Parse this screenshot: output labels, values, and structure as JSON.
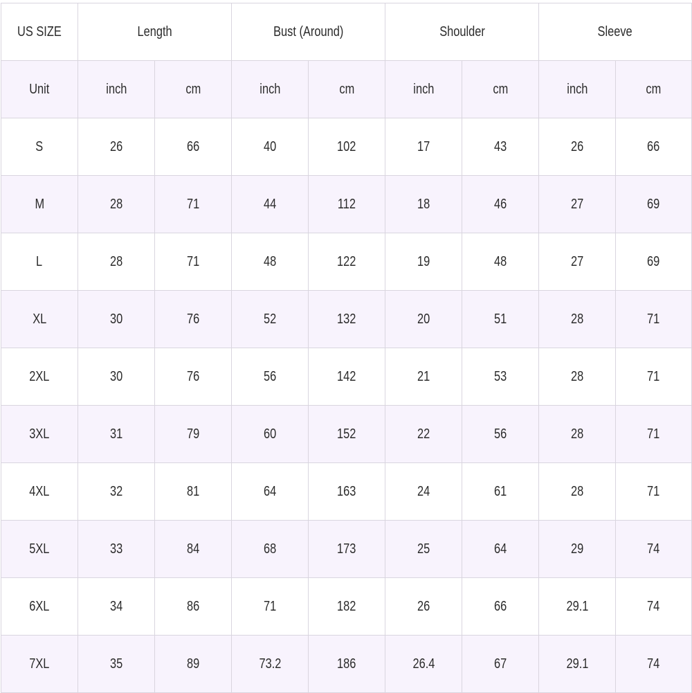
{
  "header": {
    "size_label": "US SIZE",
    "groups": [
      "Length",
      "Bust (Around)",
      "Shoulder",
      "Sleeve"
    ]
  },
  "units_row": {
    "label": "Unit",
    "units": [
      "inch",
      "cm",
      "inch",
      "cm",
      "inch",
      "cm",
      "inch",
      "cm"
    ]
  },
  "rows": [
    {
      "size": "S",
      "values": [
        "26",
        "66",
        "40",
        "102",
        "17",
        "43",
        "26",
        "66"
      ]
    },
    {
      "size": "M",
      "values": [
        "28",
        "71",
        "44",
        "112",
        "18",
        "46",
        "27",
        "69"
      ]
    },
    {
      "size": "L",
      "values": [
        "28",
        "71",
        "48",
        "122",
        "19",
        "48",
        "27",
        "69"
      ]
    },
    {
      "size": "XL",
      "values": [
        "30",
        "76",
        "52",
        "132",
        "20",
        "51",
        "28",
        "71"
      ]
    },
    {
      "size": "2XL",
      "values": [
        "30",
        "76",
        "56",
        "142",
        "21",
        "53",
        "28",
        "71"
      ]
    },
    {
      "size": "3XL",
      "values": [
        "31",
        "79",
        "60",
        "152",
        "22",
        "56",
        "28",
        "71"
      ]
    },
    {
      "size": "4XL",
      "values": [
        "32",
        "81",
        "64",
        "163",
        "24",
        "61",
        "28",
        "71"
      ]
    },
    {
      "size": "5XL",
      "values": [
        "33",
        "84",
        "68",
        "173",
        "25",
        "64",
        "29",
        "74"
      ]
    },
    {
      "size": "6XL",
      "values": [
        "34",
        "86",
        "71",
        "182",
        "26",
        "66",
        "29.1",
        "74"
      ]
    },
    {
      "size": "7XL",
      "values": [
        "35",
        "89",
        "73.2",
        "186",
        "26.4",
        "67",
        "29.1",
        "74"
      ]
    }
  ]
}
